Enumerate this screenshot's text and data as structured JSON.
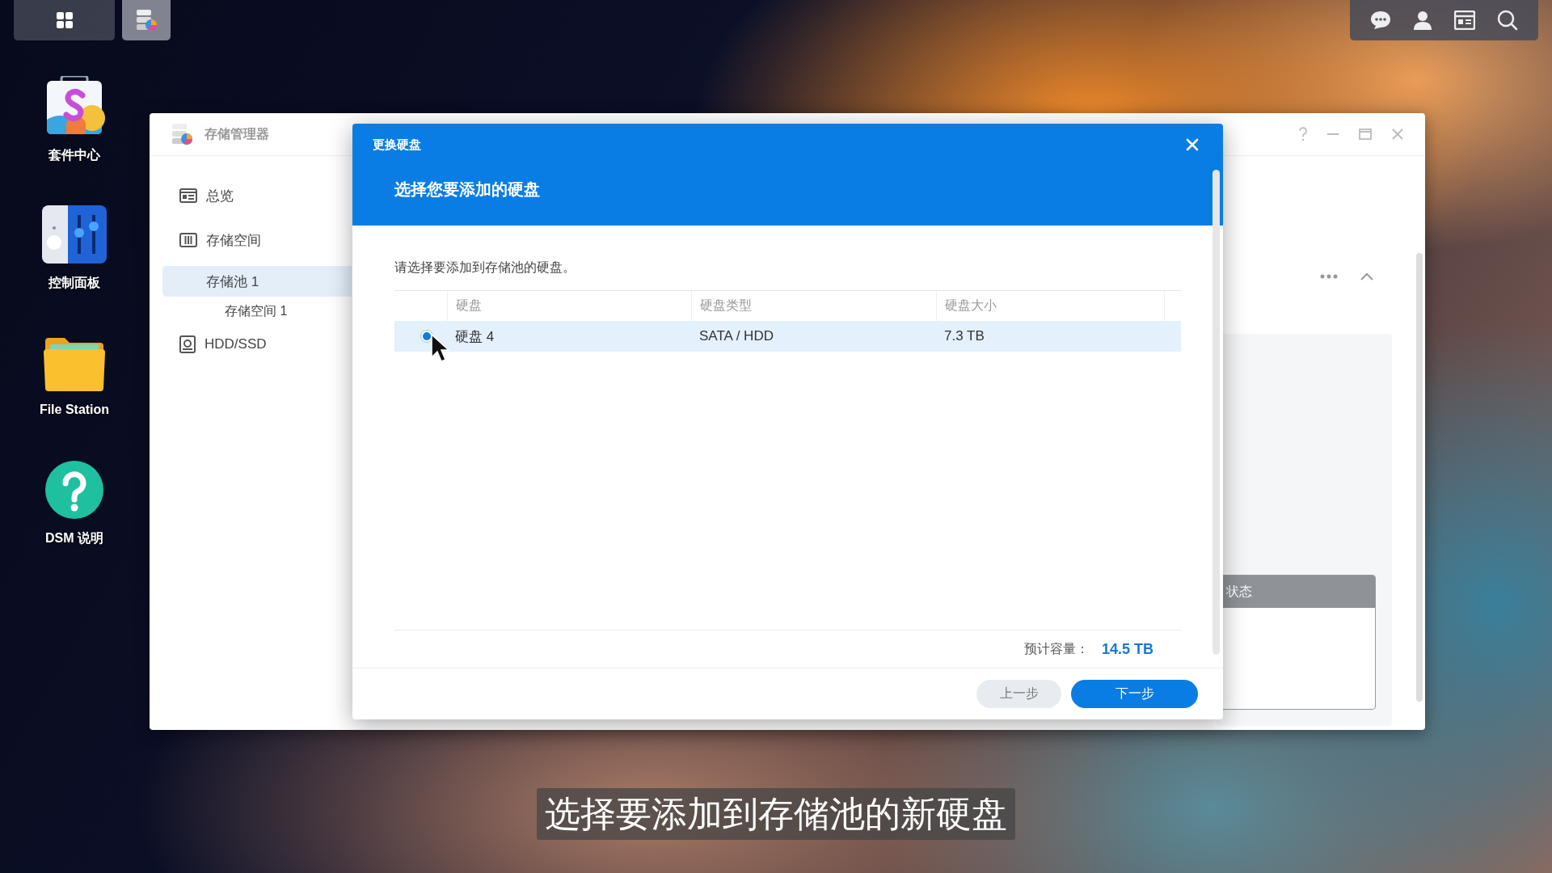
{
  "taskbar": {
    "apps": [
      {
        "kind": "main-menu",
        "selected": false
      },
      {
        "kind": "storage-manager",
        "selected": true
      }
    ]
  },
  "desktop_icons": [
    {
      "kind": "package",
      "label": "套件中心"
    },
    {
      "kind": "control",
      "label": "控制面板"
    },
    {
      "kind": "folder",
      "label": "File Station"
    },
    {
      "kind": "help",
      "label": "DSM 说明"
    }
  ],
  "window": {
    "title": "存储管理器",
    "sidebar": [
      {
        "kind": "overview",
        "label": "总览",
        "selected": false
      },
      {
        "kind": "storage",
        "label": "存储空间",
        "selected": false,
        "children": [
          {
            "label": "存储池 1",
            "selected": true,
            "children": [
              {
                "label": "存储空间 1",
                "selected": false
              }
            ]
          }
        ]
      },
      {
        "kind": "disk",
        "label": "HDD/SSD",
        "selected": false
      }
    ],
    "status_card": {
      "header": "状态"
    }
  },
  "dialog": {
    "title": "更换硬盘",
    "heading": "选择您要添加的硬盘",
    "instruction": "请选择要添加到存储池的硬盘。",
    "table": {
      "columns": [
        "硬盘",
        "硬盘类型",
        "硬盘大小"
      ],
      "rows": [
        {
          "selected": true,
          "cells": [
            "硬盘 4",
            "SATA / HDD",
            "7.3 TB"
          ]
        }
      ]
    },
    "capacity_label": "预计容量：",
    "capacity_value": "14.5 TB",
    "buttons": [
      {
        "kind": "secondary",
        "label": "上一步"
      },
      {
        "kind": "primary",
        "label": "下一步"
      }
    ]
  },
  "subtitle": "选择要添加到存储池的新硬盘"
}
